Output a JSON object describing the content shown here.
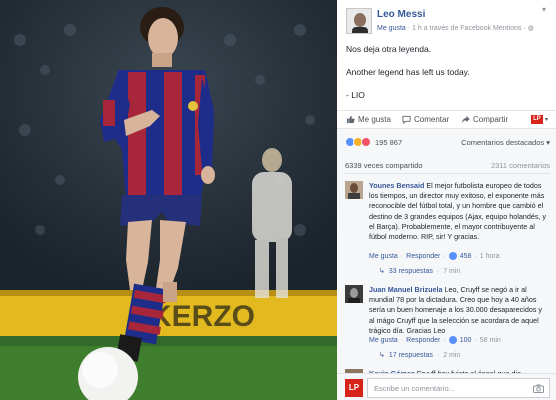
{
  "post": {
    "page_name": "Leo Messi",
    "like_link": "Me gusta",
    "timestamp": "· 1 h a través de Facebook Mentions ·",
    "lines": [
      "Nos deja otra leyenda.",
      "Another legend has left us today.",
      "- LIO"
    ]
  },
  "actions": {
    "like": "Me gusta",
    "comment": "Comentar",
    "share": "Compartir",
    "brand_badge": "LP"
  },
  "stats": {
    "reactions": "195 867",
    "featured": "Comentarios destacados",
    "shares": "6339 veces compartido",
    "comments": "2311 comentarios"
  },
  "comments": [
    {
      "author": "Younes Bensaid",
      "text": "El mejor futbolista europeo de todos los tiempos, un director muy exitoso, el exponente más reconocible del fútbol total, y un hombre que cambió el destino de 3 grandes equipos (Ajax, equipo holandés, y el Barça). Probablemente, el mayor contribuyente al fútbol moderno. RIP, sir! Y gracias.",
      "like": "Me gusta",
      "reply": "Responder",
      "likes": "458",
      "ago": "1 hora",
      "replies": "33 respuestas",
      "replies_ago": "7 min"
    },
    {
      "author": "Juan Manuel Brizuela",
      "text": "Leo, Cruyff se negó a ir al mundial 78 por la dictadura. Creo que hoy a 40 años sería un buen homenaje a los 30.000 desaparecidos y al mágo Cruyff que la selección se acordara de aquel trágico día. Gracias Leo",
      "like": "Me gusta",
      "reply": "Responder",
      "likes": "100",
      "ago": "58 min",
      "replies": "17 respuestas",
      "replies_ago": "2 min"
    },
    {
      "author": "Kevin Gómez",
      "text": "Cruyff hoy fuiste el ángel que dio"
    }
  ],
  "composer": {
    "brand": "LP",
    "placeholder": "Escribe un comentario..."
  },
  "photo": {
    "banner_text": "KERZO"
  },
  "colors": {
    "link": "#365899",
    "brand_red": "#d8231b",
    "like_blue": "#5890ff"
  }
}
